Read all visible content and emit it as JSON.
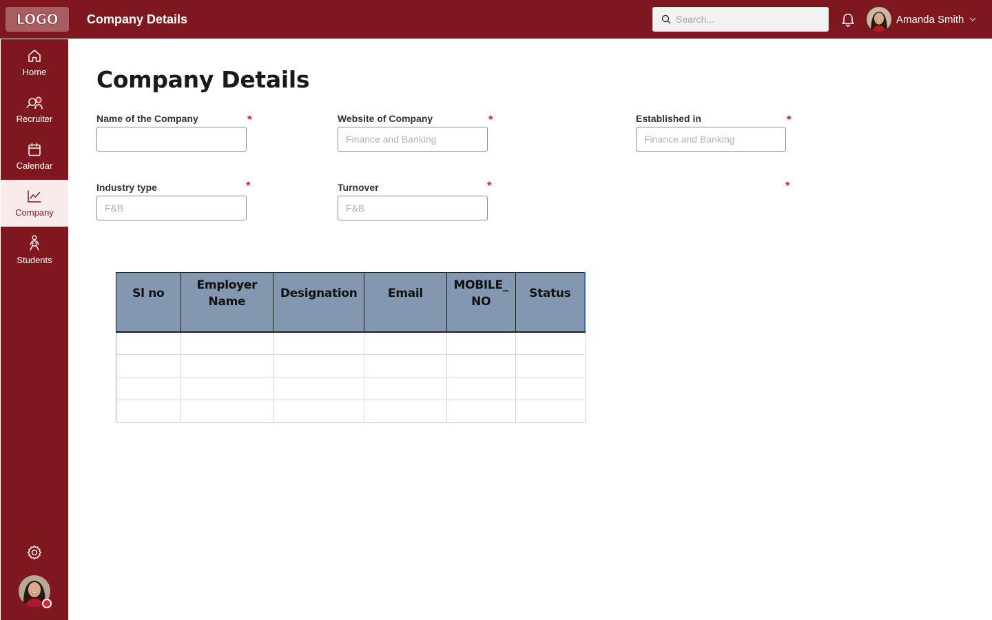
{
  "header": {
    "logo_text": "LOGO",
    "title": "Company Details",
    "search_placeholder": "Search...",
    "user_name": "Amanda Smith"
  },
  "sidebar": {
    "items": [
      {
        "label": "Home",
        "icon": "home-icon"
      },
      {
        "label": "Recruiter",
        "icon": "recruiter-icon"
      },
      {
        "label": "Calendar",
        "icon": "calendar-icon"
      },
      {
        "label": "Company",
        "icon": "chart-line-icon",
        "active": true
      },
      {
        "label": "Students",
        "icon": "student-icon"
      }
    ]
  },
  "page": {
    "title": "Company Details"
  },
  "form": {
    "company_name": {
      "label": "Name of the Company",
      "value": "",
      "placeholder": ""
    },
    "website": {
      "label": "Website of Company",
      "placeholder": "Finance and Banking"
    },
    "established": {
      "label": "Established in",
      "placeholder": "Finance and Banking"
    },
    "industry": {
      "label": "Industry type",
      "placeholder": "F&B"
    },
    "turnover": {
      "label": "Turnover",
      "placeholder": "F&B"
    },
    "required_mark": "*"
  },
  "table": {
    "headers": [
      "Sl no",
      "Employer Name",
      "Designation",
      "Email",
      "MOBILE_ NO",
      "Status"
    ],
    "rows": [
      [
        "",
        "",
        "",
        "",
        "",
        ""
      ],
      [
        "",
        "",
        "",
        "",
        "",
        ""
      ],
      [
        "",
        "",
        "",
        "",
        "",
        ""
      ],
      [
        "",
        "",
        "",
        "",
        "",
        ""
      ]
    ]
  },
  "colors": {
    "brand": "#7f171e",
    "active_nav_bg": "#f9ebec",
    "table_header": "#8497b0",
    "required": "#d6252e"
  }
}
